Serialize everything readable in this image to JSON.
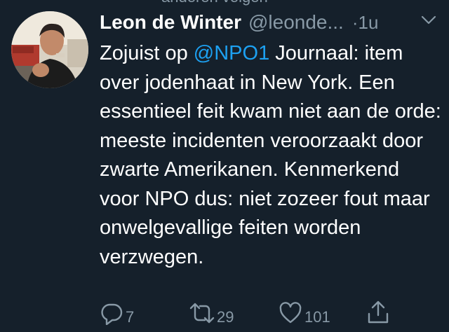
{
  "context": {
    "text": "anderen volgen"
  },
  "tweet": {
    "author": {
      "name": "Leon de Winter",
      "handle": "@leonde...",
      "avatar_icon": "profile-photo"
    },
    "time": "·1u",
    "text_before": "Zojuist op ",
    "mention": "@NPO1",
    "text_after": " Journaal: item over jodenhaat in New York. Een essentieel feit kwam niet aan de orde: meeste incidenten veroorzaakt door zwarte Amerikanen. Kenmerkend voor NPO dus: niet zozeer fout maar onwelgevallige feiten worden verzwegen."
  },
  "actions": {
    "reply": {
      "icon": "reply-icon",
      "count": "7"
    },
    "retweet": {
      "icon": "retweet-icon",
      "count": "29"
    },
    "like": {
      "icon": "heart-icon",
      "count": "101"
    },
    "share": {
      "icon": "share-icon",
      "count": ""
    }
  },
  "colors": {
    "background": "#15202b",
    "text": "#ffffff",
    "secondary": "#8899a6",
    "link": "#1da1f2"
  }
}
